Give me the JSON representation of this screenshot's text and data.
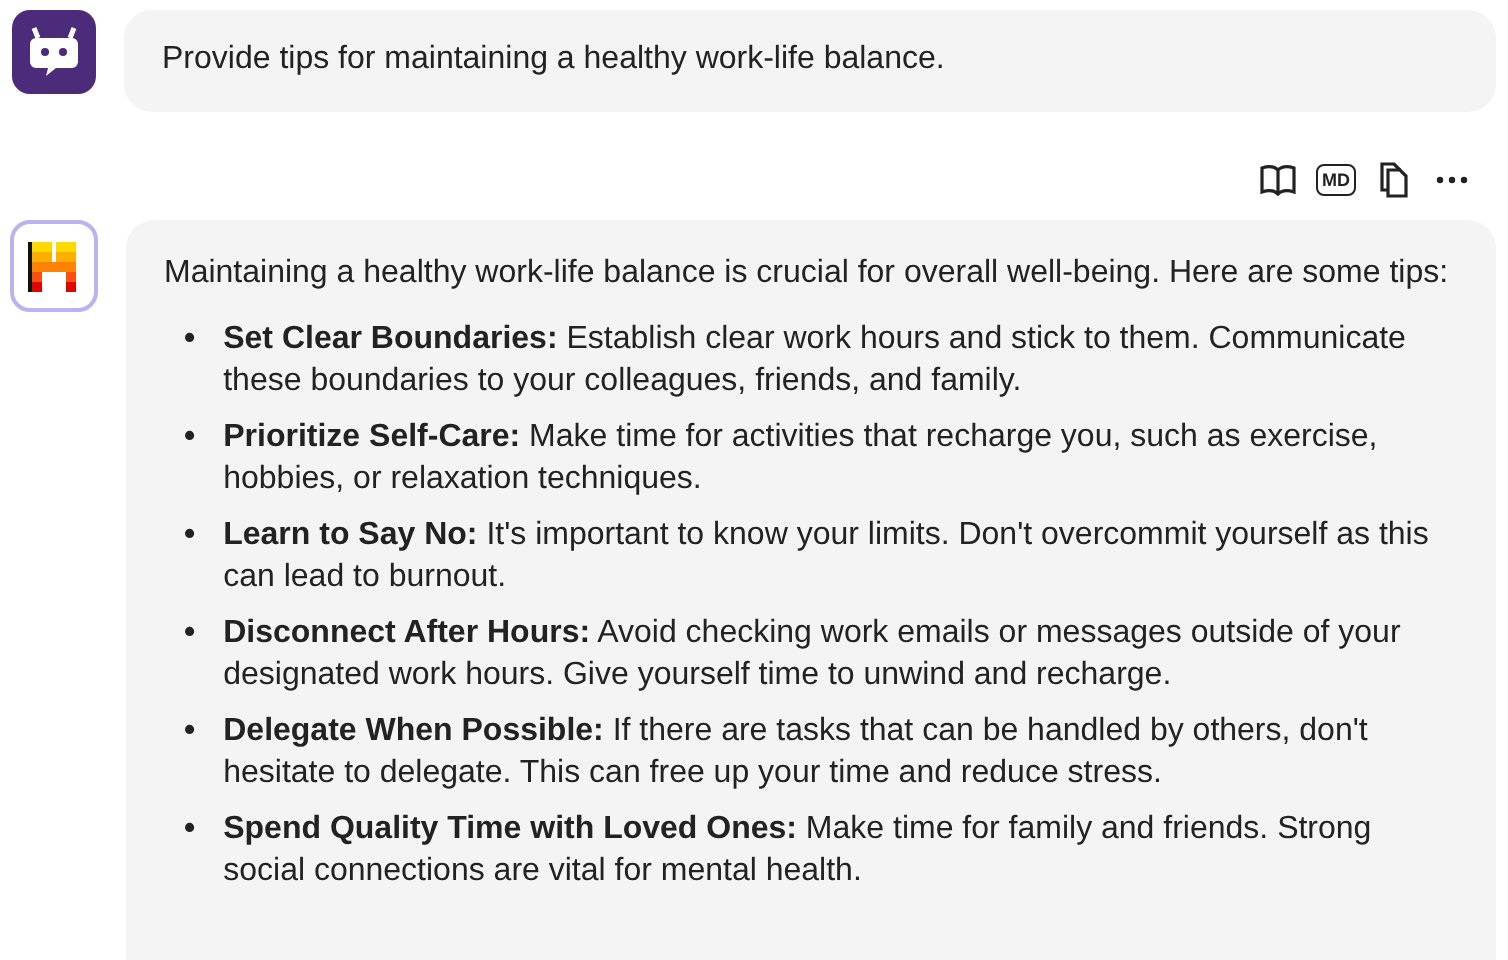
{
  "user_message": {
    "text": "Provide tips for maintaining a healthy work-life balance."
  },
  "message_actions": [
    {
      "kind": "book"
    },
    {
      "kind": "markdown",
      "label": "MD"
    },
    {
      "kind": "copy"
    },
    {
      "kind": "more"
    }
  ],
  "assistant_message": {
    "intro": "Maintaining a healthy work-life balance is crucial for overall well-being. Here are some tips:",
    "tips": [
      {
        "marker": "•",
        "title": "Set Clear Boundaries:",
        "text": "Establish clear work hours and stick to them. Communicate these boundaries to your colleagues, friends, and family."
      },
      {
        "marker": "•",
        "title": "Prioritize Self-Care:",
        "text": "Make time for activities that recharge you, such as exercise, hobbies, or relaxation techniques."
      },
      {
        "marker": "•",
        "title": "Learn to Say No:",
        "text": "It's important to know your limits. Don't overcommit yourself as this can lead to burnout."
      },
      {
        "marker": "•",
        "title": "Disconnect After Hours:",
        "text": "Avoid checking work emails or messages outside of your designated work hours. Give yourself time to unwind and recharge."
      },
      {
        "marker": "•",
        "title": "Delegate When Possible:",
        "text": "If there are tasks that can be handled by others, don't hesitate to delegate. This can free up your time and reduce stress."
      },
      {
        "marker": "•",
        "title": "Spend Quality Time with Loved Ones:",
        "text": "Make time for family and friends. Strong social connections are vital for mental health."
      }
    ]
  }
}
